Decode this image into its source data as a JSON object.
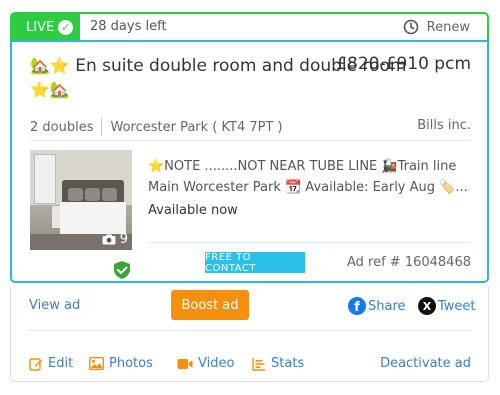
{
  "status": {
    "live_label": "LIVE",
    "days_left": "28 days left",
    "renew_label": "Renew"
  },
  "listing": {
    "title_prefix_emoji": "🏡⭐",
    "title": "En suite double room and double room",
    "title_suffix_emoji": "⭐🏡",
    "price": "£820-£910 pcm",
    "rooms": "2 doubles",
    "location": "Worcester Park ( KT4 7PT )",
    "agent": "Bills inc.",
    "photo_count": "9",
    "description": "⭐NOTE ........NOT NEAR TUBE LINE 🚂Train line Main Worcester Park 📆 Available: Early Aug 🏷️...",
    "availability": "Available now",
    "contact_label": "FREE TO CONTACT",
    "ad_ref": "Ad ref # 16048468"
  },
  "actions": {
    "view_ad": "View ad",
    "boost_ad": "Boost ad",
    "share": "Share",
    "tweet": "Tweet",
    "edit": "Edit",
    "photos": "Photos",
    "video": "Video",
    "stats": "Stats",
    "deactivate": "Deactivate ad"
  },
  "colors": {
    "live_green": "#2ecc40",
    "listing_border": "#2fb5d9",
    "boost_orange": "#f5900e",
    "link_blue": "#3a7fc1",
    "icon_orange": "#f5900e",
    "contact_cyan": "#29c1e8"
  },
  "icons": [
    "check-icon",
    "clock-icon",
    "camera-icon",
    "shield-check-icon",
    "facebook-icon",
    "x-icon",
    "edit-icon",
    "photo-icon",
    "video-icon",
    "stats-icon"
  ]
}
